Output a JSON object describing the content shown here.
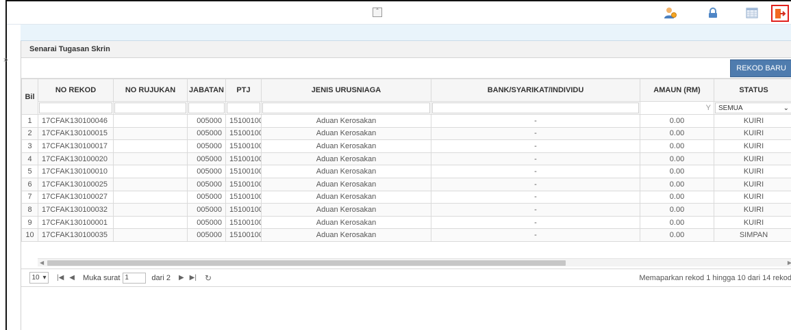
{
  "topbar": {
    "collapse_glyph": "«",
    "icons": [
      "user-settings-icon",
      "lock-icon",
      "calendar-icon",
      "exit-icon"
    ]
  },
  "sidebar": {
    "expand_glyph": "»"
  },
  "panel": {
    "title": "Senarai Tugasan Skrin",
    "new_button": "REKOD BARU"
  },
  "table": {
    "headers": {
      "bil": "Bil",
      "no_rekod": "NO REKOD",
      "no_rujukan": "NO RUJUKAN",
      "jabatan": "JABATAN",
      "ptj": "PTJ",
      "jenis": "JENIS URUSNIAGA",
      "bank": "BANK/SYARIKAT/INDIVIDU",
      "amaun": "AMAUN (RM)",
      "status": "STATUS"
    },
    "filter": {
      "status_value": "SEMUA",
      "amount_filter_glyph": "Y"
    },
    "rows": [
      {
        "bil": "1",
        "no_rekod": "17CFAK130100046",
        "no_rujukan": "",
        "jabatan": "005000",
        "ptj": "15100100",
        "jenis": "Aduan Kerosakan",
        "bank": "-",
        "amaun": "0.00",
        "status": "KUIRI"
      },
      {
        "bil": "2",
        "no_rekod": "17CFAK130100015",
        "no_rujukan": "",
        "jabatan": "005000",
        "ptj": "15100100",
        "jenis": "Aduan Kerosakan",
        "bank": "-",
        "amaun": "0.00",
        "status": "KUIRI"
      },
      {
        "bil": "3",
        "no_rekod": "17CFAK130100017",
        "no_rujukan": "",
        "jabatan": "005000",
        "ptj": "15100100",
        "jenis": "Aduan Kerosakan",
        "bank": "-",
        "amaun": "0.00",
        "status": "KUIRI"
      },
      {
        "bil": "4",
        "no_rekod": "17CFAK130100020",
        "no_rujukan": "",
        "jabatan": "005000",
        "ptj": "15100100",
        "jenis": "Aduan Kerosakan",
        "bank": "-",
        "amaun": "0.00",
        "status": "KUIRI"
      },
      {
        "bil": "5",
        "no_rekod": "17CFAK130100010",
        "no_rujukan": "",
        "jabatan": "005000",
        "ptj": "15100100",
        "jenis": "Aduan Kerosakan",
        "bank": "-",
        "amaun": "0.00",
        "status": "KUIRI"
      },
      {
        "bil": "6",
        "no_rekod": "17CFAK130100025",
        "no_rujukan": "",
        "jabatan": "005000",
        "ptj": "15100100",
        "jenis": "Aduan Kerosakan",
        "bank": "-",
        "amaun": "0.00",
        "status": "KUIRI"
      },
      {
        "bil": "7",
        "no_rekod": "17CFAK130100027",
        "no_rujukan": "",
        "jabatan": "005000",
        "ptj": "15100100",
        "jenis": "Aduan Kerosakan",
        "bank": "-",
        "amaun": "0.00",
        "status": "KUIRI"
      },
      {
        "bil": "8",
        "no_rekod": "17CFAK130100032",
        "no_rujukan": "",
        "jabatan": "005000",
        "ptj": "15100100",
        "jenis": "Aduan Kerosakan",
        "bank": "-",
        "amaun": "0.00",
        "status": "KUIRI"
      },
      {
        "bil": "9",
        "no_rekod": "17CFAK130100001",
        "no_rujukan": "",
        "jabatan": "005000",
        "ptj": "15100100",
        "jenis": "Aduan Kerosakan",
        "bank": "-",
        "amaun": "0.00",
        "status": "KUIRI"
      },
      {
        "bil": "10",
        "no_rekod": "17CFAK130100035",
        "no_rujukan": "",
        "jabatan": "005000",
        "ptj": "15100100",
        "jenis": "Aduan Kerosakan",
        "bank": "-",
        "amaun": "0.00",
        "status": "SIMPAN"
      }
    ]
  },
  "pager": {
    "page_size": "10",
    "page_label": "Muka surat",
    "current_page": "1",
    "of_label": "dari 2",
    "info": "Memaparkan rekod 1 hingga 10 dari 14 rekod"
  },
  "colors": {
    "accent": "#4f7cae",
    "highlight": "#e0201c",
    "subbar": "#e9f4fb"
  }
}
